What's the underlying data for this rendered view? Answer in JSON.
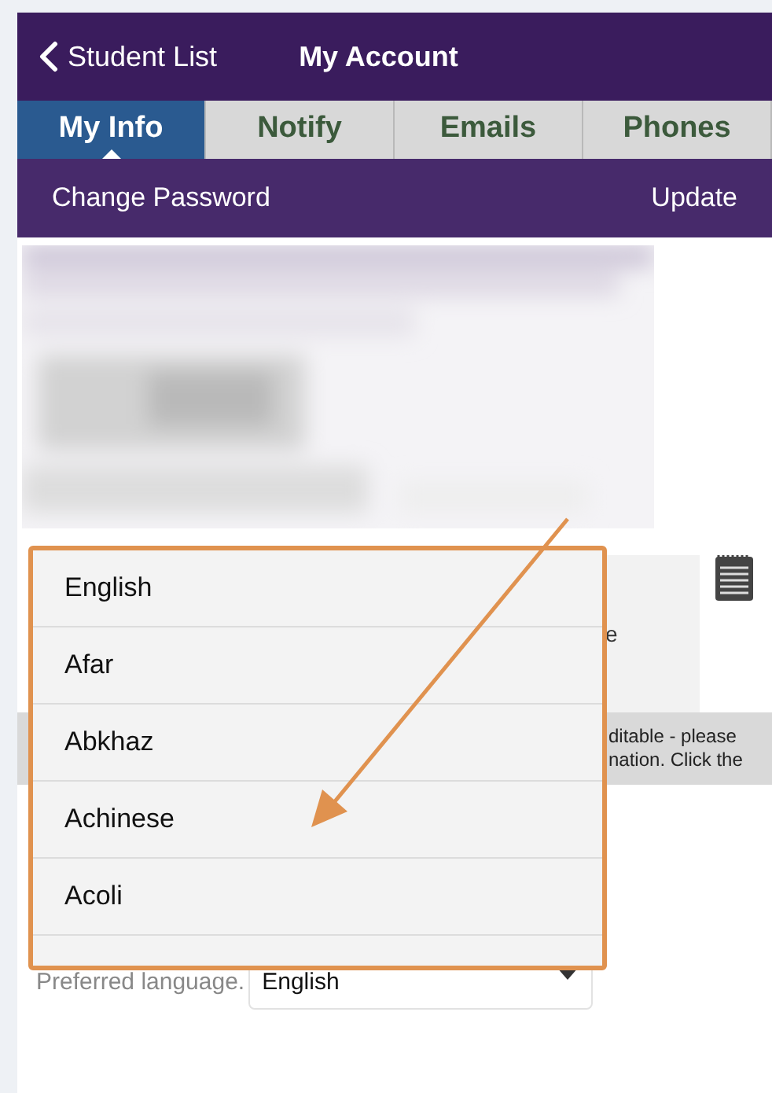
{
  "header": {
    "back_label": "Student List",
    "title": "My Account"
  },
  "tabs": [
    {
      "label": "My Info",
      "selected": true
    },
    {
      "label": "Notify",
      "selected": false
    },
    {
      "label": "Emails",
      "selected": false
    },
    {
      "label": "Phones",
      "selected": false
    }
  ],
  "action_bar": {
    "left": "Change Password",
    "right": "Update"
  },
  "details": {
    "partial_text": "e",
    "notice_lines": [
      "ditable - please",
      "nation. Click the"
    ]
  },
  "language_dropdown": {
    "options": [
      "English",
      "Afar",
      "Abkhaz",
      "Achinese",
      "Acoli"
    ]
  },
  "preferred_language": {
    "label": "Preferred language.",
    "value": "English"
  }
}
